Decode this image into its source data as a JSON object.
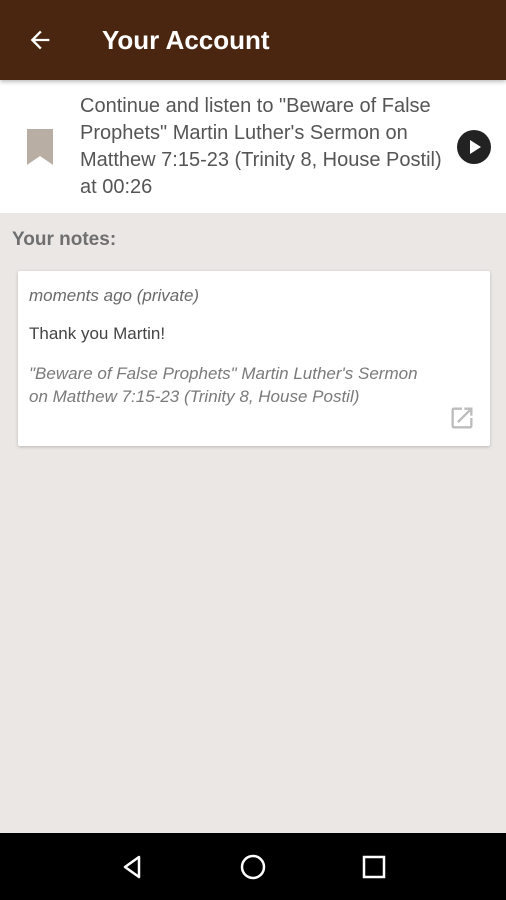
{
  "app_bar": {
    "title": "Your Account",
    "back_icon": "arrow-left-icon",
    "background_color": "#4a250f"
  },
  "continue_banner": {
    "icon": "bookmark-icon",
    "text": "Continue and listen to \"Beware of False Prophets\" Martin Luther's Sermon on Matthew 7:15-23 (Trinity 8, House Postil) at 00:26",
    "play_icon": "play-circle-icon"
  },
  "notes": {
    "heading": "Your notes:",
    "items": [
      {
        "meta": "moments ago (private)",
        "body": "Thank you Martin!",
        "source": "\"Beware of False Prophets\" Martin Luther's Sermon on Matthew 7:15-23 (Trinity 8, House Postil)",
        "open_icon": "open-in-new-icon"
      }
    ]
  },
  "nav_bar": {
    "back_icon": "nav-back-triangle-icon",
    "home_icon": "nav-home-circle-icon",
    "recents_icon": "nav-recents-square-icon"
  }
}
